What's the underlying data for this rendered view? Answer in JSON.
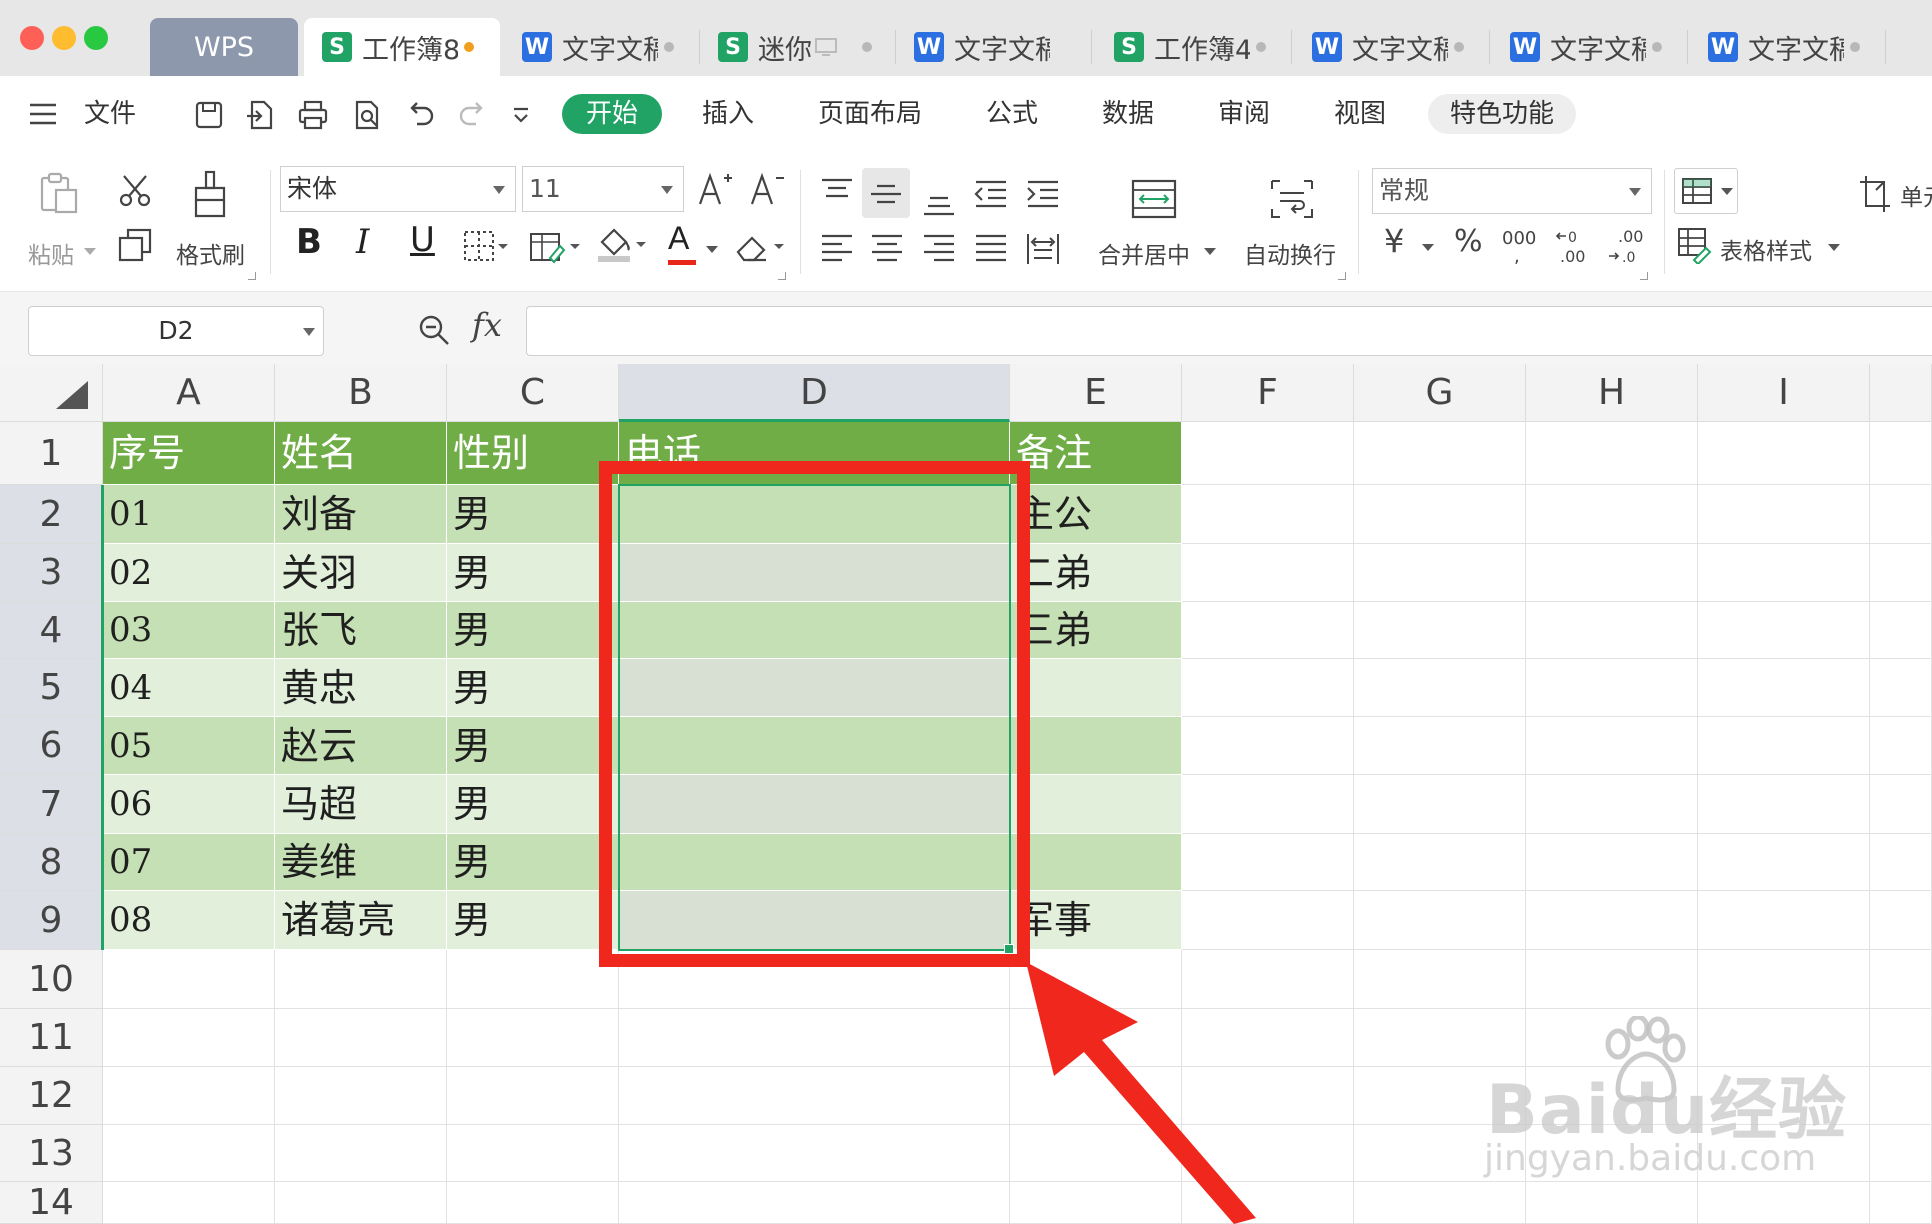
{
  "tabbar": {
    "tabs": [
      {
        "label": "WPS",
        "type": "home"
      },
      {
        "label": "工作簿8",
        "type": "s",
        "dot": "orange",
        "active": true
      },
      {
        "label": "文字文稿",
        "type": "w",
        "dot": "grey"
      },
      {
        "label": "迷你",
        "type": "s",
        "dot": "grey",
        "icon_after": "monitor-icon"
      },
      {
        "label": "文字文稿",
        "type": "w",
        "dot": ""
      },
      {
        "label": "工作簿4",
        "type": "s",
        "dot": "grey"
      },
      {
        "label": "文字文稿",
        "type": "w",
        "dot": "grey"
      },
      {
        "label": "文字文稿",
        "type": "w",
        "dot": "grey"
      },
      {
        "label": "文字文稿",
        "type": "w",
        "dot": "grey"
      }
    ],
    "file_icon_letters": {
      "s": "S",
      "w": "W"
    }
  },
  "menubar": {
    "file_label": "文件",
    "start_label": "开始",
    "items": [
      "插入",
      "页面布局",
      "公式",
      "数据",
      "审阅",
      "视图"
    ],
    "special_label": "特色功能"
  },
  "ribbon": {
    "paste_label": "粘贴",
    "format_painter_label": "格式刷",
    "font_name": "宋体",
    "font_size": "11",
    "bold": "B",
    "italic": "I",
    "underline": "U",
    "merge_center_label": "合并居中",
    "wrap_text_label": "自动换行",
    "number_format": "常规",
    "currency_symbol": "¥",
    "percent_symbol": "%",
    "thousands_label": "000",
    "table_style_label": "表格样式",
    "cell_label": "单元",
    "accent_color": "#21a366",
    "font_color_bar": "#e8261a"
  },
  "formula_bar": {
    "name_box": "D2",
    "fx_label": "fx",
    "value": ""
  },
  "grid": {
    "columns": [
      "A",
      "B",
      "C",
      "D",
      "E",
      "F",
      "G",
      "H",
      "I"
    ],
    "selected_column": "D",
    "row_numbers": [
      "1",
      "2",
      "3",
      "4",
      "5",
      "6",
      "7",
      "8",
      "9",
      "10",
      "11",
      "12",
      "13",
      "14"
    ],
    "header_row": [
      "序号",
      "姓名",
      "性别",
      "电话",
      "备注"
    ],
    "rows": [
      [
        "01",
        "刘备",
        "男",
        "",
        "主公"
      ],
      [
        "02",
        "关羽",
        "男",
        "",
        "二弟"
      ],
      [
        "03",
        "张飞",
        "男",
        "",
        "三弟"
      ],
      [
        "04",
        "黄忠",
        "男",
        "",
        ""
      ],
      [
        "05",
        "赵云",
        "男",
        "",
        ""
      ],
      [
        "06",
        "马超",
        "男",
        "",
        ""
      ],
      [
        "07",
        "姜维",
        "男",
        "",
        ""
      ],
      [
        "08",
        "诸葛亮",
        "男",
        "",
        "军事"
      ]
    ],
    "table_header_color": "#70ad47",
    "band_dark_color": "#c5e0b4",
    "band_light_color": "#e2efda"
  },
  "annotation": {
    "highlight_color": "#f0271d"
  },
  "watermark": {
    "brand": "Baidu经验",
    "url": "jingyan.baidu.com"
  }
}
